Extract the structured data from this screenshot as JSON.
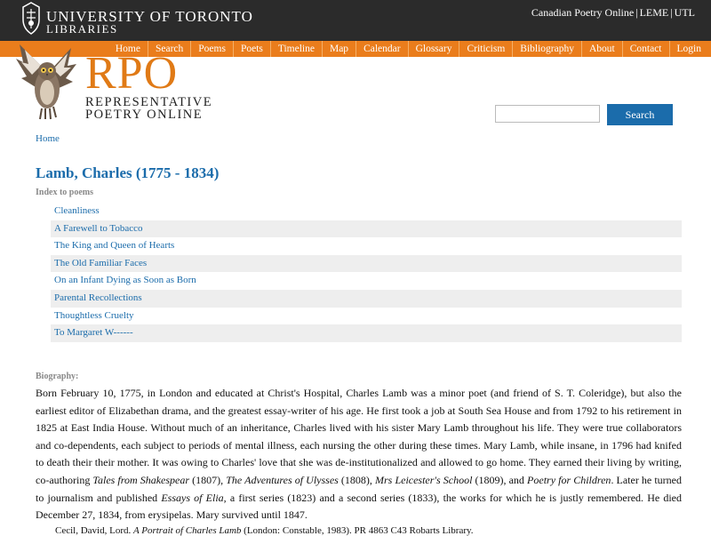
{
  "header": {
    "university_line1": "UNIVERSITY OF TORONTO",
    "university_line2": "LIBRARIES",
    "top_links": [
      "Canadian Poetry Online",
      "LEME",
      "UTL"
    ],
    "top_link_separator": "|"
  },
  "nav": {
    "items": [
      "Home",
      "Search",
      "Poems",
      "Poets",
      "Timeline",
      "Map",
      "Calendar",
      "Glossary",
      "Criticism",
      "Bibliography",
      "About",
      "Contact",
      "Login"
    ],
    "background_color": "#ea7d1c"
  },
  "logo": {
    "acronym": "RPO",
    "line1": "REPRESENTATIVE",
    "line2": "POETRY ONLINE",
    "accent_color": "#e07a16"
  },
  "search": {
    "value": "",
    "button_label": "Search",
    "button_color": "#1b6cab"
  },
  "breadcrumb": {
    "home": "Home"
  },
  "poet": {
    "title": "Lamb, Charles (1775 - 1834)",
    "index_label": "Index to poems",
    "poems": [
      "Cleanliness",
      "A Farewell to Tobacco",
      "The King and Queen of Hearts",
      "The Old Familiar Faces",
      "On an Infant Dying as Soon as Born",
      "Parental Recollections",
      "Thoughtless Cruelty",
      "To Margaret W------"
    ]
  },
  "biography": {
    "label": "Biography:",
    "p1": "Born February 10, 1775, in London and educated at Christ's Hospital, Charles Lamb was a minor poet (and friend of S. T. Coleridge), but also the earliest editor of Elizabethan drama, and the greatest essay-writer of his age. He first took a job at South Sea House and from 1792 to his retirement in 1825 at East India House. Without much of an inheritance, Charles lived with his sister Mary Lamb throughout his life. They were true collaborators and co-dependents, each subject to periods of mental illness, each nursing the other during these times. Mary Lamb, while insane, in 1796 had knifed to death their their mother. It was owing to Charles' love that she was de-institutionalized and allowed to go home. They earned their living by writing, co-authoring ",
    "work1": "Tales from Shakespear",
    "p2": " (1807), ",
    "work2": "The Adventures of Ulysses",
    "p3": " (1808), ",
    "work3": "Mrs Leicester's School",
    "p4": " (1809), and ",
    "work4": "Poetry for Children",
    "p5": ". Later he turned to journalism and published ",
    "work5": "Essays of Elia",
    "p6": ", a first series (1823) and a second series (1833), the works for which he is justly remembered. He died December 27, 1834, from erysipelas. Mary survived until 1847."
  },
  "citation": {
    "author": "Cecil, David, Lord. ",
    "title": "A Portrait of Charles Lamb",
    "rest": " (London: Constable, 1983). PR 4863 C43 Robarts Library."
  },
  "link_color": "#1b6cab"
}
